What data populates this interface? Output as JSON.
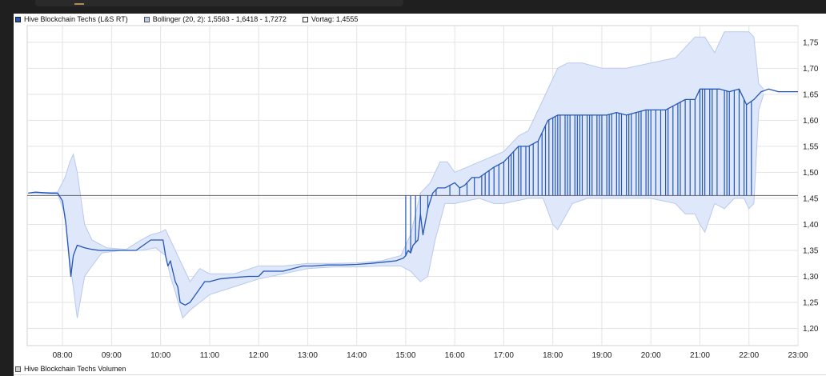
{
  "legend": {
    "main": {
      "label": "Hive Blockchain Techs (L&S RT)",
      "color": "#2456b8"
    },
    "bollinger": {
      "label": "Bollinger (20, 2): 1,5563 - 1,6418 - 1,7272",
      "color": "#b9c9ec"
    },
    "prev": {
      "label": "Vortag: 1,4555",
      "color": "#ffffff"
    }
  },
  "volume_legend": {
    "label": "Hive Blockchain Techs Volumen"
  },
  "colors": {
    "price": "#2456b8",
    "band_fill": "#dfe8fa",
    "band_edge": "#b9c9ec",
    "prev_line": "#666666",
    "grid": "#e3e3e3"
  },
  "chart_data": {
    "type": "line",
    "x_ticks": [
      "08:00",
      "09:00",
      "10:00",
      "11:00",
      "12:00",
      "13:00",
      "14:00",
      "15:00",
      "16:00",
      "17:00",
      "18:00",
      "19:00",
      "20:00",
      "21:00",
      "22:00",
      "23:00"
    ],
    "y_ticks": [
      "1,75",
      "1,70",
      "1,65",
      "1,60",
      "1,55",
      "1,50",
      "1,45",
      "1,40",
      "1,35",
      "1,30",
      "1,25",
      "1,20"
    ],
    "ylim": [
      1.167,
      1.782
    ],
    "xlim_hours": [
      7.28,
      23.0
    ],
    "previous_close": 1.4555,
    "series": [
      {
        "name": "Hive Blockchain Techs (L&S RT)",
        "kind": "price",
        "points": [
          [
            7.3,
            1.46
          ],
          [
            7.45,
            1.462
          ],
          [
            7.6,
            1.461
          ],
          [
            7.75,
            1.46
          ],
          [
            7.9,
            1.46
          ],
          [
            8.0,
            1.445
          ],
          [
            8.07,
            1.4
          ],
          [
            8.12,
            1.35
          ],
          [
            8.17,
            1.3
          ],
          [
            8.22,
            1.34
          ],
          [
            8.3,
            1.36
          ],
          [
            8.45,
            1.355
          ],
          [
            8.6,
            1.352
          ],
          [
            8.75,
            1.35
          ],
          [
            8.9,
            1.35
          ],
          [
            9.1,
            1.35
          ],
          [
            9.3,
            1.35
          ],
          [
            9.5,
            1.35
          ],
          [
            9.65,
            1.36
          ],
          [
            9.8,
            1.37
          ],
          [
            9.95,
            1.37
          ],
          [
            10.05,
            1.37
          ],
          [
            10.1,
            1.34
          ],
          [
            10.15,
            1.32
          ],
          [
            10.2,
            1.33
          ],
          [
            10.25,
            1.31
          ],
          [
            10.3,
            1.29
          ],
          [
            10.35,
            1.28
          ],
          [
            10.4,
            1.25
          ],
          [
            10.5,
            1.245
          ],
          [
            10.6,
            1.25
          ],
          [
            10.75,
            1.27
          ],
          [
            10.9,
            1.29
          ],
          [
            11.0,
            1.29
          ],
          [
            11.2,
            1.295
          ],
          [
            11.5,
            1.298
          ],
          [
            11.8,
            1.3
          ],
          [
            12.0,
            1.3
          ],
          [
            12.1,
            1.31
          ],
          [
            12.3,
            1.31
          ],
          [
            12.5,
            1.31
          ],
          [
            12.7,
            1.315
          ],
          [
            12.9,
            1.32
          ],
          [
            13.1,
            1.32
          ],
          [
            13.4,
            1.322
          ],
          [
            13.7,
            1.322
          ],
          [
            14.0,
            1.323
          ],
          [
            14.3,
            1.325
          ],
          [
            14.6,
            1.328
          ],
          [
            14.8,
            1.33
          ],
          [
            14.95,
            1.335
          ],
          [
            15.0,
            1.34
          ],
          [
            15.05,
            1.35
          ],
          [
            15.1,
            1.345
          ],
          [
            15.15,
            1.36
          ],
          [
            15.25,
            1.37
          ],
          [
            15.3,
            1.42
          ],
          [
            15.35,
            1.38
          ],
          [
            15.45,
            1.43
          ],
          [
            15.55,
            1.46
          ],
          [
            15.65,
            1.47
          ],
          [
            15.8,
            1.47
          ],
          [
            16.0,
            1.48
          ],
          [
            16.1,
            1.47
          ],
          [
            16.2,
            1.475
          ],
          [
            16.35,
            1.49
          ],
          [
            16.5,
            1.49
          ],
          [
            16.65,
            1.5
          ],
          [
            16.8,
            1.51
          ],
          [
            17.0,
            1.52
          ],
          [
            17.1,
            1.53
          ],
          [
            17.3,
            1.55
          ],
          [
            17.5,
            1.55
          ],
          [
            17.7,
            1.56
          ],
          [
            17.9,
            1.6
          ],
          [
            18.1,
            1.61
          ],
          [
            18.3,
            1.61
          ],
          [
            18.6,
            1.61
          ],
          [
            18.9,
            1.61
          ],
          [
            19.1,
            1.61
          ],
          [
            19.3,
            1.615
          ],
          [
            19.5,
            1.61
          ],
          [
            19.7,
            1.615
          ],
          [
            19.9,
            1.62
          ],
          [
            20.1,
            1.62
          ],
          [
            20.3,
            1.62
          ],
          [
            20.5,
            1.63
          ],
          [
            20.7,
            1.64
          ],
          [
            20.9,
            1.64
          ],
          [
            21.0,
            1.66
          ],
          [
            21.2,
            1.66
          ],
          [
            21.4,
            1.66
          ],
          [
            21.6,
            1.655
          ],
          [
            21.8,
            1.66
          ],
          [
            21.95,
            1.63
          ],
          [
            22.1,
            1.64
          ],
          [
            22.25,
            1.655
          ],
          [
            22.4,
            1.66
          ],
          [
            22.6,
            1.655
          ],
          [
            22.8,
            1.655
          ],
          [
            23.0,
            1.655
          ]
        ],
        "spike_base": 1.4555,
        "spikes_x": [
          15.0,
          15.1,
          15.2,
          15.3,
          15.45,
          15.62,
          15.9,
          16.1,
          16.25,
          16.4,
          16.55,
          16.62,
          16.7,
          16.8,
          16.9,
          17.0,
          17.1,
          17.15,
          17.2,
          17.3,
          17.35,
          17.45,
          17.52,
          17.6,
          17.7,
          17.78,
          17.85,
          17.92,
          18.0,
          18.05,
          18.1,
          18.15,
          18.25,
          18.3,
          18.35,
          18.45,
          18.5,
          18.55,
          18.6,
          18.7,
          18.75,
          18.8,
          18.9,
          18.95,
          19.0,
          19.1,
          19.15,
          19.2,
          19.3,
          19.35,
          19.4,
          19.5,
          19.55,
          19.6,
          19.7,
          19.75,
          19.8,
          19.9,
          19.95,
          20.0,
          20.1,
          20.2,
          20.3,
          20.35,
          20.45,
          20.55,
          20.6,
          20.7,
          20.8,
          20.9,
          21.0,
          21.05,
          21.1,
          21.2,
          21.25,
          21.35,
          21.5,
          21.55,
          21.6,
          21.7,
          21.8,
          21.9,
          21.95,
          22.05
        ]
      },
      {
        "name": "Bollinger (20, 2)",
        "kind": "band",
        "upper": [
          [
            7.3,
            1.46
          ],
          [
            7.6,
            1.461
          ],
          [
            7.9,
            1.462
          ],
          [
            8.05,
            1.49
          ],
          [
            8.15,
            1.52
          ],
          [
            8.22,
            1.535
          ],
          [
            8.3,
            1.5
          ],
          [
            8.45,
            1.4
          ],
          [
            8.6,
            1.37
          ],
          [
            8.9,
            1.355
          ],
          [
            9.3,
            1.352
          ],
          [
            9.6,
            1.37
          ],
          [
            9.8,
            1.38
          ],
          [
            10.0,
            1.385
          ],
          [
            10.1,
            1.39
          ],
          [
            10.2,
            1.37
          ],
          [
            10.3,
            1.35
          ],
          [
            10.4,
            1.33
          ],
          [
            10.6,
            1.29
          ],
          [
            10.8,
            1.315
          ],
          [
            11.0,
            1.305
          ],
          [
            11.5,
            1.305
          ],
          [
            12.0,
            1.32
          ],
          [
            12.5,
            1.32
          ],
          [
            13.0,
            1.325
          ],
          [
            13.5,
            1.325
          ],
          [
            14.0,
            1.326
          ],
          [
            14.5,
            1.33
          ],
          [
            14.9,
            1.34
          ],
          [
            15.1,
            1.38
          ],
          [
            15.3,
            1.46
          ],
          [
            15.5,
            1.48
          ],
          [
            15.7,
            1.52
          ],
          [
            15.85,
            1.52
          ],
          [
            16.0,
            1.5
          ],
          [
            16.5,
            1.52
          ],
          [
            17.0,
            1.54
          ],
          [
            17.3,
            1.57
          ],
          [
            17.5,
            1.58
          ],
          [
            17.8,
            1.64
          ],
          [
            18.1,
            1.7
          ],
          [
            18.3,
            1.71
          ],
          [
            18.6,
            1.71
          ],
          [
            19.0,
            1.7
          ],
          [
            19.5,
            1.7
          ],
          [
            20.0,
            1.71
          ],
          [
            20.5,
            1.72
          ],
          [
            20.9,
            1.76
          ],
          [
            21.1,
            1.76
          ],
          [
            21.3,
            1.73
          ],
          [
            21.5,
            1.77
          ],
          [
            21.8,
            1.77
          ],
          [
            22.0,
            1.77
          ],
          [
            22.1,
            1.76
          ],
          [
            22.2,
            1.67
          ],
          [
            22.3,
            1.66
          ]
        ],
        "lower": [
          [
            7.3,
            1.46
          ],
          [
            7.6,
            1.459
          ],
          [
            7.9,
            1.458
          ],
          [
            8.05,
            1.42
          ],
          [
            8.15,
            1.33
          ],
          [
            8.3,
            1.22
          ],
          [
            8.45,
            1.3
          ],
          [
            8.6,
            1.32
          ],
          [
            8.8,
            1.345
          ],
          [
            9.2,
            1.35
          ],
          [
            9.6,
            1.35
          ],
          [
            9.9,
            1.355
          ],
          [
            10.1,
            1.34
          ],
          [
            10.2,
            1.3
          ],
          [
            10.3,
            1.27
          ],
          [
            10.45,
            1.22
          ],
          [
            10.6,
            1.235
          ],
          [
            10.8,
            1.25
          ],
          [
            11.0,
            1.265
          ],
          [
            11.5,
            1.28
          ],
          [
            12.0,
            1.295
          ],
          [
            12.5,
            1.305
          ],
          [
            13.0,
            1.315
          ],
          [
            13.5,
            1.318
          ],
          [
            14.0,
            1.318
          ],
          [
            14.5,
            1.32
          ],
          [
            14.9,
            1.32
          ],
          [
            15.1,
            1.31
          ],
          [
            15.3,
            1.29
          ],
          [
            15.45,
            1.3
          ],
          [
            15.6,
            1.37
          ],
          [
            15.8,
            1.44
          ],
          [
            16.0,
            1.44
          ],
          [
            16.5,
            1.45
          ],
          [
            16.8,
            1.44
          ],
          [
            17.0,
            1.44
          ],
          [
            17.5,
            1.45
          ],
          [
            17.8,
            1.45
          ],
          [
            18.0,
            1.4
          ],
          [
            18.1,
            1.39
          ],
          [
            18.4,
            1.44
          ],
          [
            18.7,
            1.45
          ],
          [
            19.0,
            1.45
          ],
          [
            19.5,
            1.45
          ],
          [
            20.0,
            1.45
          ],
          [
            20.5,
            1.44
          ],
          [
            20.7,
            1.42
          ],
          [
            20.9,
            1.42
          ],
          [
            21.0,
            1.4
          ],
          [
            21.1,
            1.385
          ],
          [
            21.3,
            1.44
          ],
          [
            21.5,
            1.43
          ],
          [
            21.7,
            1.45
          ],
          [
            21.9,
            1.45
          ],
          [
            22.0,
            1.43
          ],
          [
            22.1,
            1.44
          ],
          [
            22.2,
            1.62
          ],
          [
            22.3,
            1.65
          ]
        ]
      }
    ]
  }
}
